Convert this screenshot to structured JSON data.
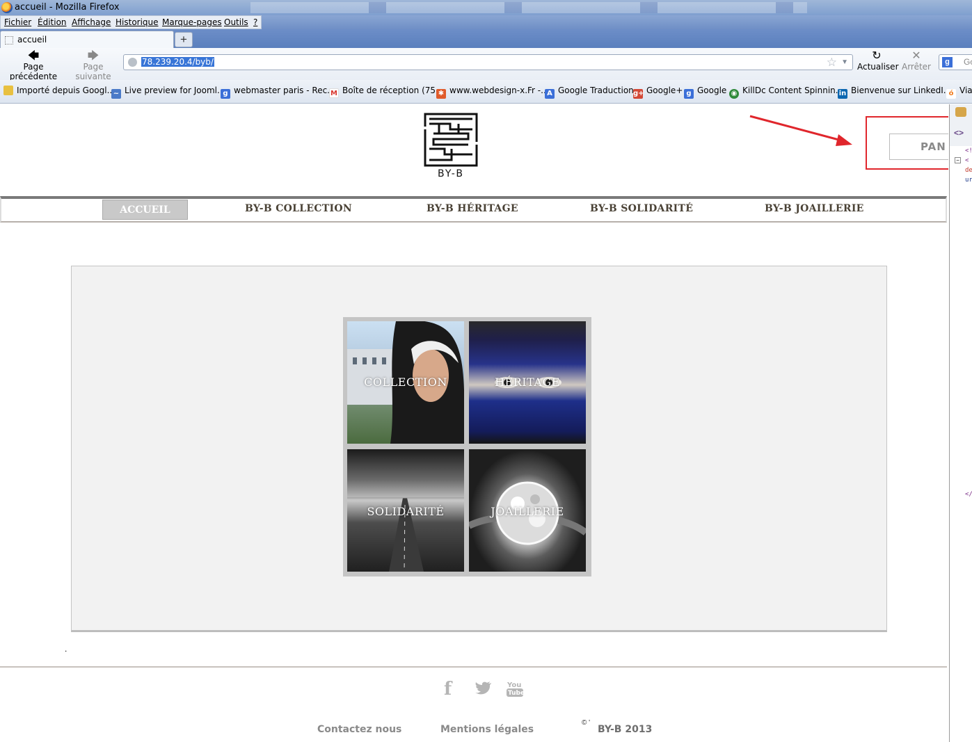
{
  "window": {
    "title": "accueil - Mozilla Firefox"
  },
  "menubar": {
    "items": [
      "Fichier",
      "Édition",
      "Affichage",
      "Historique",
      "Marque-pages",
      "Outils",
      "?"
    ]
  },
  "tabs": {
    "active_label": "accueil",
    "new_tab": "+"
  },
  "navbar": {
    "back_label": "Page précédente",
    "forward_label": "Page suivante",
    "url": "78.239.20.4/byb/",
    "reload_label": "Actualiser",
    "stop_label": "Arrêter",
    "search_text": "Go"
  },
  "bookmarks": [
    {
      "label": "Importé depuis Googl...",
      "icon": "folder-icon",
      "color": "#e8c040"
    },
    {
      "label": "Live preview for Jooml...",
      "icon": "wave-icon",
      "color": "#4a7ac8"
    },
    {
      "label": "webmaster paris - Rec...",
      "icon": "google-icon",
      "color": "#3b6fd8"
    },
    {
      "label": "Boîte de réception (75...",
      "icon": "gmail-icon",
      "color": "#d9382f"
    },
    {
      "label": "www.webdesign-x.Fr -...",
      "icon": "joomla-icon",
      "color": "#e05b2b"
    },
    {
      "label": "Google Traduction",
      "icon": "translate-icon",
      "color": "#3b6fd8"
    },
    {
      "label": "Google+",
      "icon": "googleplus-icon",
      "color": "#d34836"
    },
    {
      "label": "Google",
      "icon": "google-icon",
      "color": "#3b6fd8"
    },
    {
      "label": "KillDc Content Spinnin...",
      "icon": "killdc-icon",
      "color": "#2f8a3a"
    },
    {
      "label": "Bienvenue sur LinkedI...",
      "icon": "linkedin-icon",
      "color": "#0b66b0"
    },
    {
      "label": "Via",
      "icon": "viadeo-icon",
      "color": "#f07a1a"
    }
  ],
  "site": {
    "logo_text": "BY-B",
    "panier_label": "PAN",
    "nav": {
      "accueil": "ACCUEIL",
      "collection": "BY-B COLLECTION",
      "heritage": "BY-B HÉRITAGE",
      "solidarite": "BY-B SOLIDARITÉ",
      "joaillerie": "BY-B JOAILLERIE"
    },
    "tiles": {
      "collection": "COLLECTION",
      "heritage": "HÉRITAGE",
      "solidarite": "SOLIDARITÉ",
      "joaillerie": "JOAILLERIE"
    },
    "dot": ".",
    "footer": {
      "contact": "Contactez nous",
      "mentions": "Mentions légales",
      "copyright_symbol": "© '",
      "copyright": "BY-B 2013"
    }
  },
  "colors": {
    "annotation_red": "#e0262c",
    "nav_text": "#4a4236",
    "panel_bg": "#f2f2f2"
  },
  "devpanel": {
    "code_lines": [
      "<!",
      "<",
      "de",
      "ur",
      "</"
    ]
  }
}
